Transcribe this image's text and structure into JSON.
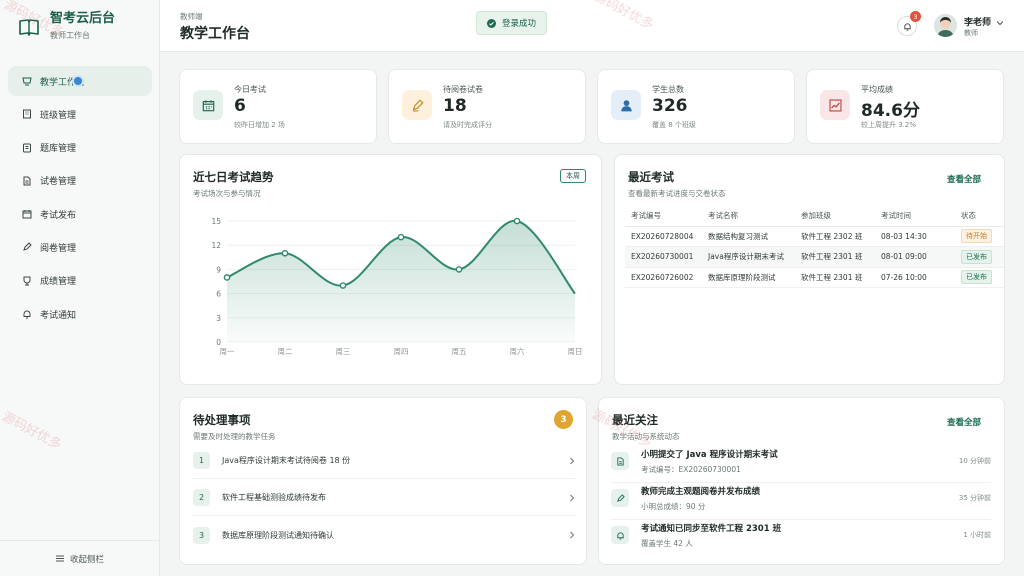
{
  "sidebar": {
    "brand_title": "智考云后台",
    "brand_subtitle": "教师工作台",
    "items": [
      {
        "label": "教学工作台",
        "icon": "dashboard-icon"
      },
      {
        "label": "班级管理",
        "icon": "building-icon"
      },
      {
        "label": "题库管理",
        "icon": "book-icon"
      },
      {
        "label": "试卷管理",
        "icon": "document-icon"
      },
      {
        "label": "考试发布",
        "icon": "calendar-icon"
      },
      {
        "label": "阅卷管理",
        "icon": "pen-icon"
      },
      {
        "label": "成绩管理",
        "icon": "award-icon"
      },
      {
        "label": "考试通知",
        "icon": "bell-icon"
      }
    ],
    "collapse_label": "收起侧栏"
  },
  "header": {
    "breadcrumb": "教师端",
    "title": "教学工作台",
    "toast": "登录成功",
    "notification_count": "3",
    "user_name": "李老师",
    "user_role": "教师"
  },
  "stats": [
    {
      "label": "今日考试",
      "value": "6",
      "sub": "较昨日增加 2 场",
      "icon": "calendar-icon",
      "color": "#e5f2ec"
    },
    {
      "label": "待阅卷试卷",
      "value": "18",
      "sub": "请及时完成评分",
      "icon": "pen-icon",
      "color": "#fdf1de"
    },
    {
      "label": "学生总数",
      "value": "326",
      "sub": "覆盖 8 个班级",
      "icon": "user-icon",
      "color": "#e3eef8"
    },
    {
      "label": "平均成绩",
      "value": "84.6分",
      "sub": "较上周提升 3.2%",
      "icon": "trend-icon",
      "color": "#fae6e6"
    }
  ],
  "trend": {
    "title": "近七日考试趋势",
    "subtitle": "考试场次与参与情况",
    "tag": "本周"
  },
  "chart_data": {
    "type": "area",
    "categories": [
      "周一",
      "周二",
      "周三",
      "周四",
      "周五",
      "周六",
      "周日"
    ],
    "values": [
      8,
      11,
      7,
      13,
      9,
      15,
      6
    ],
    "yticks": [
      0,
      3,
      6,
      9,
      12,
      15
    ],
    "ylim": [
      0,
      15
    ],
    "grid": true,
    "color": "#2f8a6c"
  },
  "recent_exams": {
    "title": "最近考试",
    "subtitle": "查看最新考试进度与交卷状态",
    "view_all": "查看全部",
    "columns": [
      "考试编号",
      "考试名称",
      "参加班级",
      "考试时间",
      "状态"
    ],
    "rows": [
      {
        "id": "EX20260728004",
        "name": "数据结构复习测试",
        "class": "软件工程 2302 班",
        "time": "08-03 14:30",
        "status": "待开始"
      },
      {
        "id": "EX20260730001",
        "name": "Java程序设计期末考试",
        "class": "软件工程 2301 班",
        "time": "08-01 09:00",
        "status": "已发布"
      },
      {
        "id": "EX20260726002",
        "name": "数据库原理阶段测试",
        "class": "软件工程 2301 班",
        "time": "07-26 10:00",
        "status": "已发布"
      }
    ]
  },
  "todos": {
    "title": "待处理事项",
    "subtitle": "需要及时处理的教学任务",
    "count": "3",
    "items": [
      {
        "num": "1",
        "text": "Java程序设计期末考试待阅卷 18 份"
      },
      {
        "num": "2",
        "text": "软件工程基础测验成绩待发布"
      },
      {
        "num": "3",
        "text": "数据库原理阶段测试通知待确认"
      }
    ]
  },
  "activity": {
    "title": "最近关注",
    "subtitle": "教学活动与系统动态",
    "view_all": "查看全部",
    "items": [
      {
        "title": "小明提交了 Java 程序设计期末考试",
        "desc": "考试编号：EX20260730001",
        "time": "10 分钟前",
        "icon": "file-icon"
      },
      {
        "title": "教师完成主观题阅卷并发布成绩",
        "desc": "小明总成绩：90 分",
        "time": "35 分钟前",
        "icon": "pen-icon"
      },
      {
        "title": "考试通知已同步至软件工程 2301 班",
        "desc": "覆盖学生 42 人",
        "time": "1 小时前",
        "icon": "bell-icon"
      }
    ]
  },
  "watermark": "源码好优多"
}
